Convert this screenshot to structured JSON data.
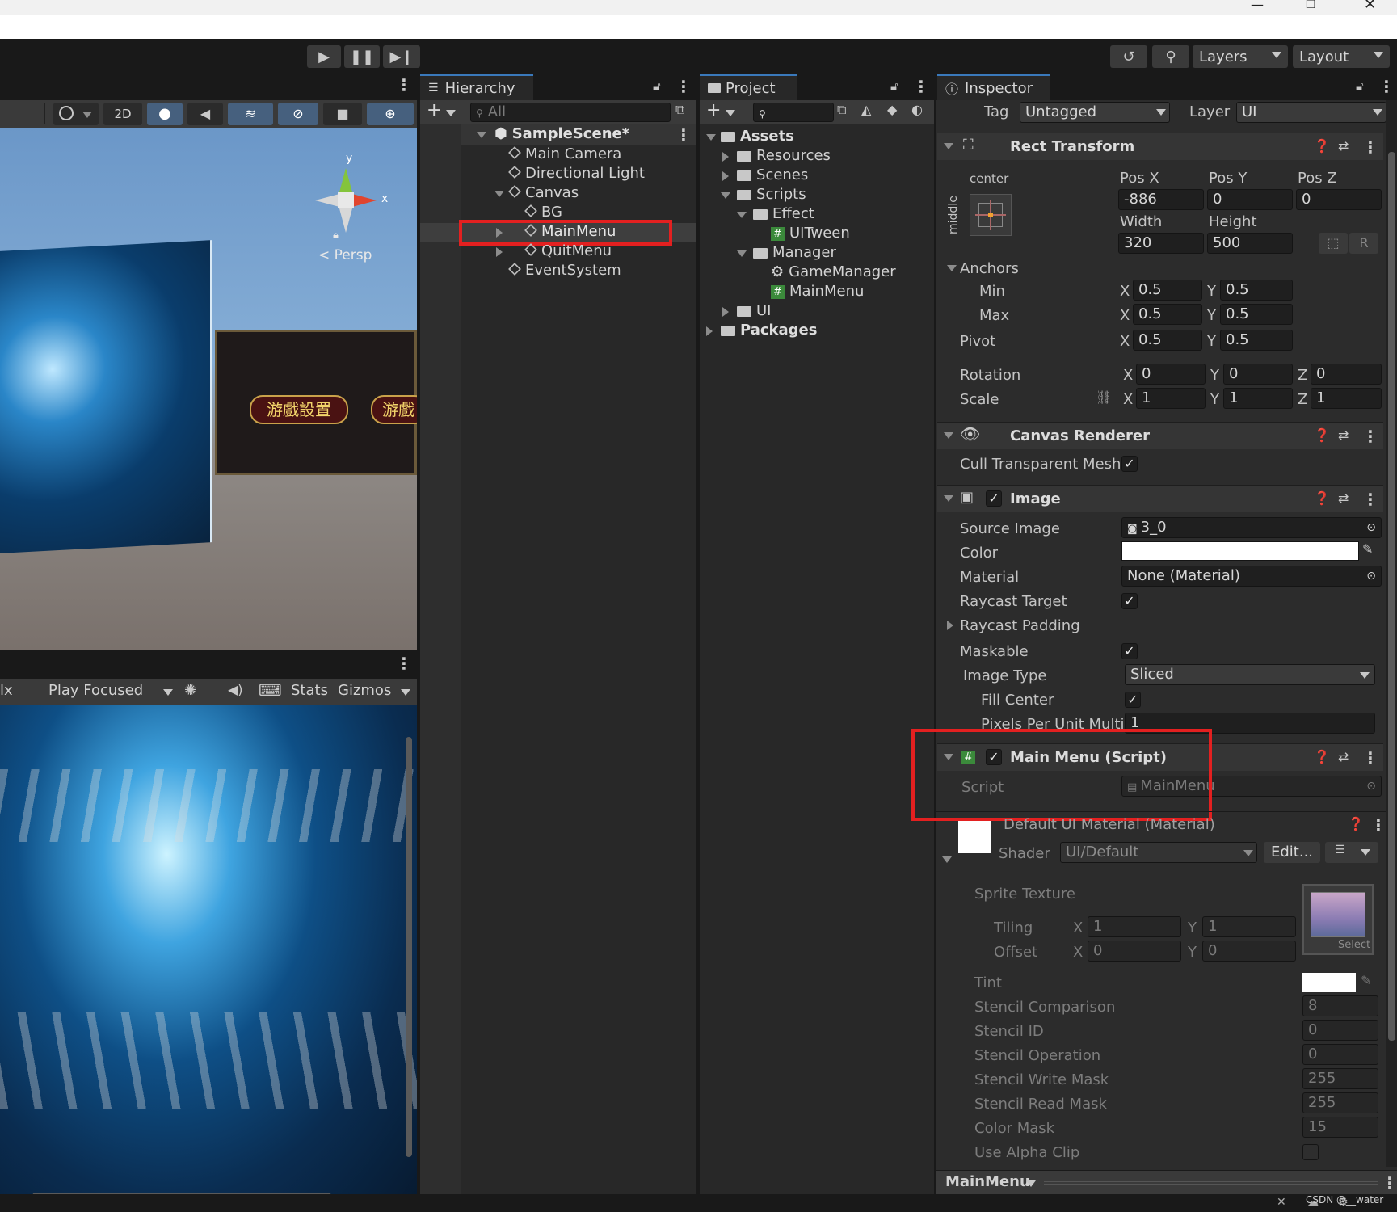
{
  "toolbar": {
    "layers_label": "Layers",
    "layout_label": "Layout"
  },
  "scene_toolbar": {
    "mode_2d": "2D",
    "persp": "< Persp",
    "gizmo_y": "y",
    "gizmo_x": "x",
    "banner_text": "游戲設置",
    "banner_text2": "游戲"
  },
  "game_toolbar": {
    "scale_fragment": "lx",
    "play_focused": "Play Focused",
    "stats": "Stats",
    "gizmos": "Gizmos"
  },
  "hierarchy": {
    "tab": "Hierarchy",
    "search_placeholder": "All",
    "items": [
      {
        "label": "SampleScene*",
        "level": 0
      },
      {
        "label": "Main Camera",
        "level": 1
      },
      {
        "label": "Directional Light",
        "level": 1
      },
      {
        "label": "Canvas",
        "level": 1
      },
      {
        "label": "BG",
        "level": 2
      },
      {
        "label": "MainMenu",
        "level": 2
      },
      {
        "label": "QuitMenu",
        "level": 2
      },
      {
        "label": "EventSystem",
        "level": 1
      }
    ]
  },
  "project": {
    "tab": "Project",
    "items": [
      {
        "label": "Assets"
      },
      {
        "label": "Resources"
      },
      {
        "label": "Scenes"
      },
      {
        "label": "Scripts"
      },
      {
        "label": "Effect"
      },
      {
        "label": "UITween"
      },
      {
        "label": "Manager"
      },
      {
        "label": "GameManager"
      },
      {
        "label": "MainMenu"
      },
      {
        "label": "UI"
      },
      {
        "label": "Packages"
      }
    ]
  },
  "inspector": {
    "tab": "Inspector",
    "tag_label": "Tag",
    "tag_value": "Untagged",
    "layer_label": "Layer",
    "layer_value": "UI",
    "rect_transform": {
      "title": "Rect Transform",
      "anchor_preset_h": "center",
      "anchor_preset_v": "middle",
      "posx_label": "Pos X",
      "posy_label": "Pos Y",
      "posz_label": "Pos Z",
      "posx": "-886",
      "posy": "0",
      "posz": "0",
      "width_label": "Width",
      "height_label": "Height",
      "width": "320",
      "height": "500",
      "r_button": "R",
      "anchors_label": "Anchors",
      "min_label": "Min",
      "max_label": "Max",
      "pivot_label": "Pivot",
      "x_lbl": "X",
      "y_lbl": "Y",
      "z_lbl": "Z",
      "min_x": "0.5",
      "min_y": "0.5",
      "max_x": "0.5",
      "max_y": "0.5",
      "pivot_x": "0.5",
      "pivot_y": "0.5",
      "rotation_label": "Rotation",
      "rot_x": "0",
      "rot_y": "0",
      "rot_z": "0",
      "scale_label": "Scale",
      "scale_x": "1",
      "scale_y": "1",
      "scale_z": "1"
    },
    "canvas_renderer": {
      "title": "Canvas Renderer",
      "cull_label": "Cull Transparent Mesh"
    },
    "image": {
      "title": "Image",
      "source_image_label": "Source Image",
      "source_image_value": "3_0",
      "color_label": "Color",
      "material_label": "Material",
      "material_value": "None (Material)",
      "raycast_target_label": "Raycast Target",
      "raycast_padding_label": "Raycast Padding",
      "maskable_label": "Maskable",
      "image_type_label": "Image Type",
      "image_type_value": "Sliced",
      "fill_center_label": "Fill Center",
      "ppu_label": "Pixels Per Unit Multi",
      "ppu_value": "1"
    },
    "main_menu_script": {
      "title": "Main Menu (Script)",
      "script_label": "Script",
      "script_value": "MainMenu"
    },
    "material": {
      "title": "Default UI Material (Material)",
      "shader_label": "Shader",
      "shader_value": "UI/Default",
      "edit_button": "Edit...",
      "sprite_texture_label": "Sprite Texture",
      "select_label": "Select",
      "tiling_label": "Tiling",
      "offset_label": "Offset",
      "tiling_x": "1",
      "tiling_y": "1",
      "offset_x": "0",
      "offset_y": "0",
      "tint_label": "Tint",
      "props": [
        {
          "label": "Stencil Comparison",
          "value": "8"
        },
        {
          "label": "Stencil ID",
          "value": "0"
        },
        {
          "label": "Stencil Operation",
          "value": "0"
        },
        {
          "label": "Stencil Write Mask",
          "value": "255"
        },
        {
          "label": "Stencil Read Mask",
          "value": "255"
        },
        {
          "label": "Color Mask",
          "value": "15"
        },
        {
          "label": "Use Alpha Clip",
          "value": ""
        }
      ]
    },
    "footer_label": "MainMenu"
  },
  "watermark": "CSDN @__water",
  "colors": {
    "accent": "#3a79bb",
    "highlight_red": "#e32020",
    "panel_bg": "#282828",
    "field_bg": "#1f1f1f"
  }
}
